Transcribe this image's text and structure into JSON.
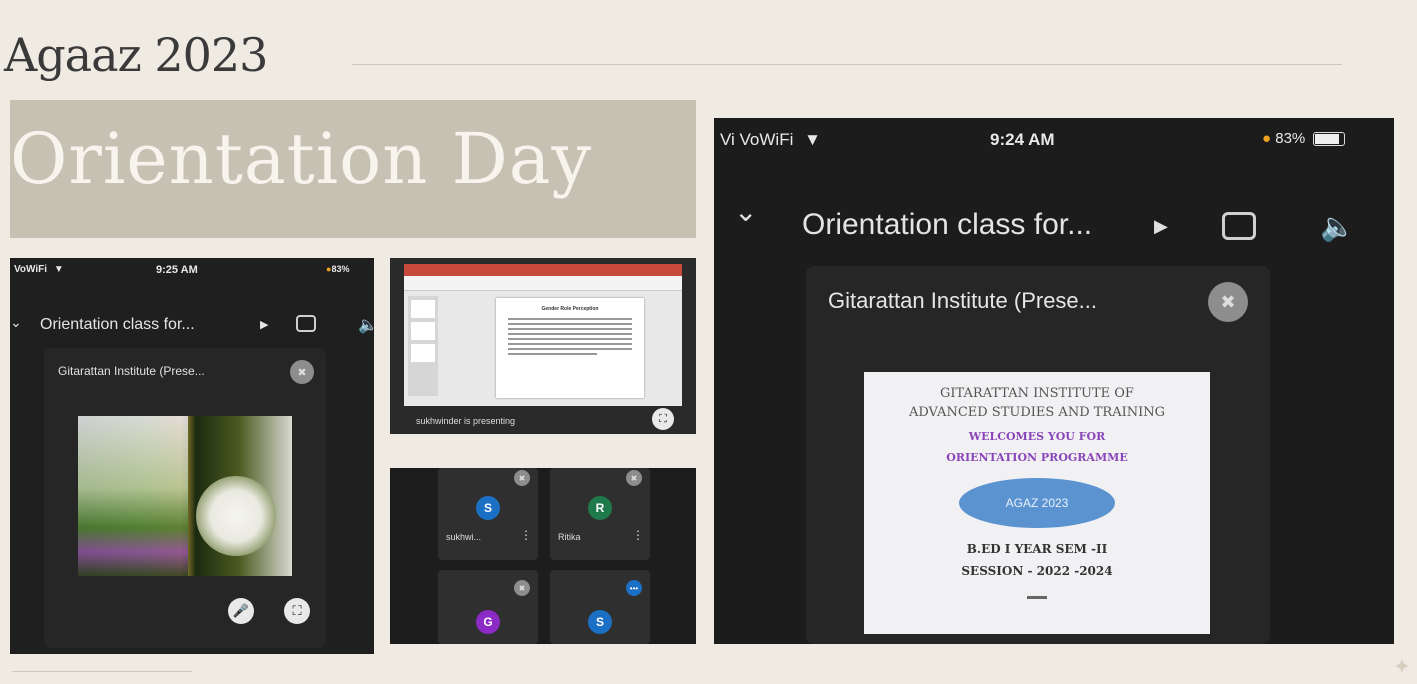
{
  "heading": "Agaaz 2023",
  "banner": "Orientation Day",
  "left_phone": {
    "status_left": "VoWiFi",
    "status_time": "9:25 AM",
    "status_right": "83%",
    "meeting_title": "Orientation class for...",
    "presenter_tile": "Gitarattan Institute (Prese..."
  },
  "middle_top": {
    "slide_title": "Gender Role Perception",
    "presenting_label": "sukhwinder is presenting"
  },
  "middle_bottom": {
    "participants": [
      {
        "initial": "S",
        "name": "sukhwi..."
      },
      {
        "initial": "R",
        "name": "Ritika"
      },
      {
        "initial": "G",
        "name": ""
      },
      {
        "initial": "S",
        "name": ""
      }
    ]
  },
  "right_phone": {
    "status_left": "Vi VoWiFi",
    "status_time": "9:24 AM",
    "status_right": "83%",
    "meeting_title": "Orientation class for...",
    "presenter_tile": "Gitarattan Institute (Prese...",
    "slide": {
      "line1": "GITARATTAN INSTITUTE OF",
      "line2": "ADVANCED STUDIES AND TRAINING",
      "line3": "WELCOMES YOU FOR",
      "line4": "ORIENTATION PROGRAMME",
      "cloud": "AGAZ 2023",
      "line5": "B.ED I YEAR SEM -II",
      "line6": "SESSION - 2022 -2024"
    }
  },
  "colors": {
    "background": "#efebe3",
    "banner": "#c7c1b3",
    "phone": "#1f1f1f"
  }
}
